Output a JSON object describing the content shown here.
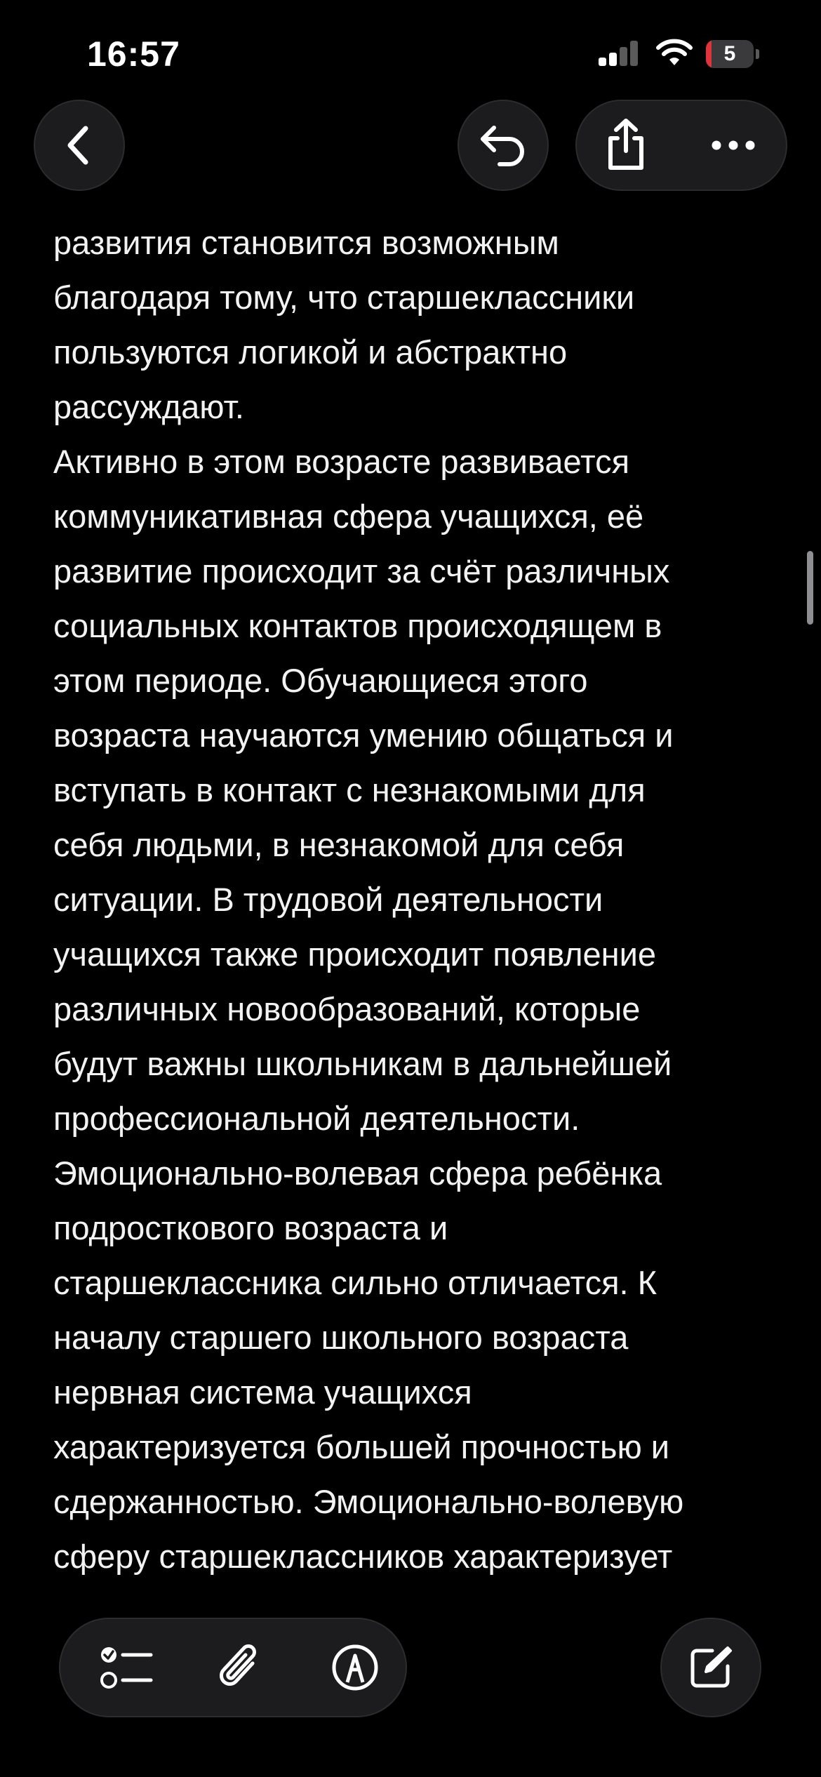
{
  "status_bar": {
    "time": "16:57",
    "battery_level": "5",
    "battery_fraction": 0.05,
    "signal_bars_active": 2,
    "signal_bars_total": 4
  },
  "colors": {
    "background": "#000000",
    "text": "#f2f2f2",
    "button_bg": "#1c1c1e",
    "battery_low": "#e0333b"
  },
  "nav": {
    "back_icon": "chevron-left-icon",
    "undo_icon": "undo-arrow-icon",
    "share_icon": "share-icon",
    "more_icon": "ellipsis-icon"
  },
  "note": {
    "lines": [
      "развития становится возможным",
      "благодаря тому, что старшеклассники",
      "пользуются логикой и абстрактно",
      "рассуждают.",
      "Активно в этом возрасте развивается",
      "коммуникативная сфера учащихся, её",
      "развитие происходит за счёт различных",
      "социальных контактов происходящем в",
      "этом периоде. Обучающиеся этого",
      "возраста научаются умению общаться и",
      "вступать в контакт с незнакомыми для",
      "себя людьми, в незнакомой для себя",
      "ситуации. В трудовой деятельности",
      "учащихся также происходит появление",
      "различных новообразований, которые",
      "будут важны школьникам в дальнейшей",
      "профессиональной деятельности.",
      "Эмоционально-волевая сфера ребёнка",
      "подросткового возраста и",
      "старшеклассника сильно отличается. К",
      "началу старшего школьного возраста",
      "нервная система учащихся",
      "характеризуется большей прочностью и",
      "сдержанностью. Эмоционально-волевую",
      "сферу старшеклассников характеризует"
    ]
  },
  "toolbar": {
    "checklist_icon": "checklist-icon",
    "attach_icon": "paperclip-icon",
    "markup_icon": "markup-pen-icon",
    "compose_icon": "compose-icon"
  }
}
